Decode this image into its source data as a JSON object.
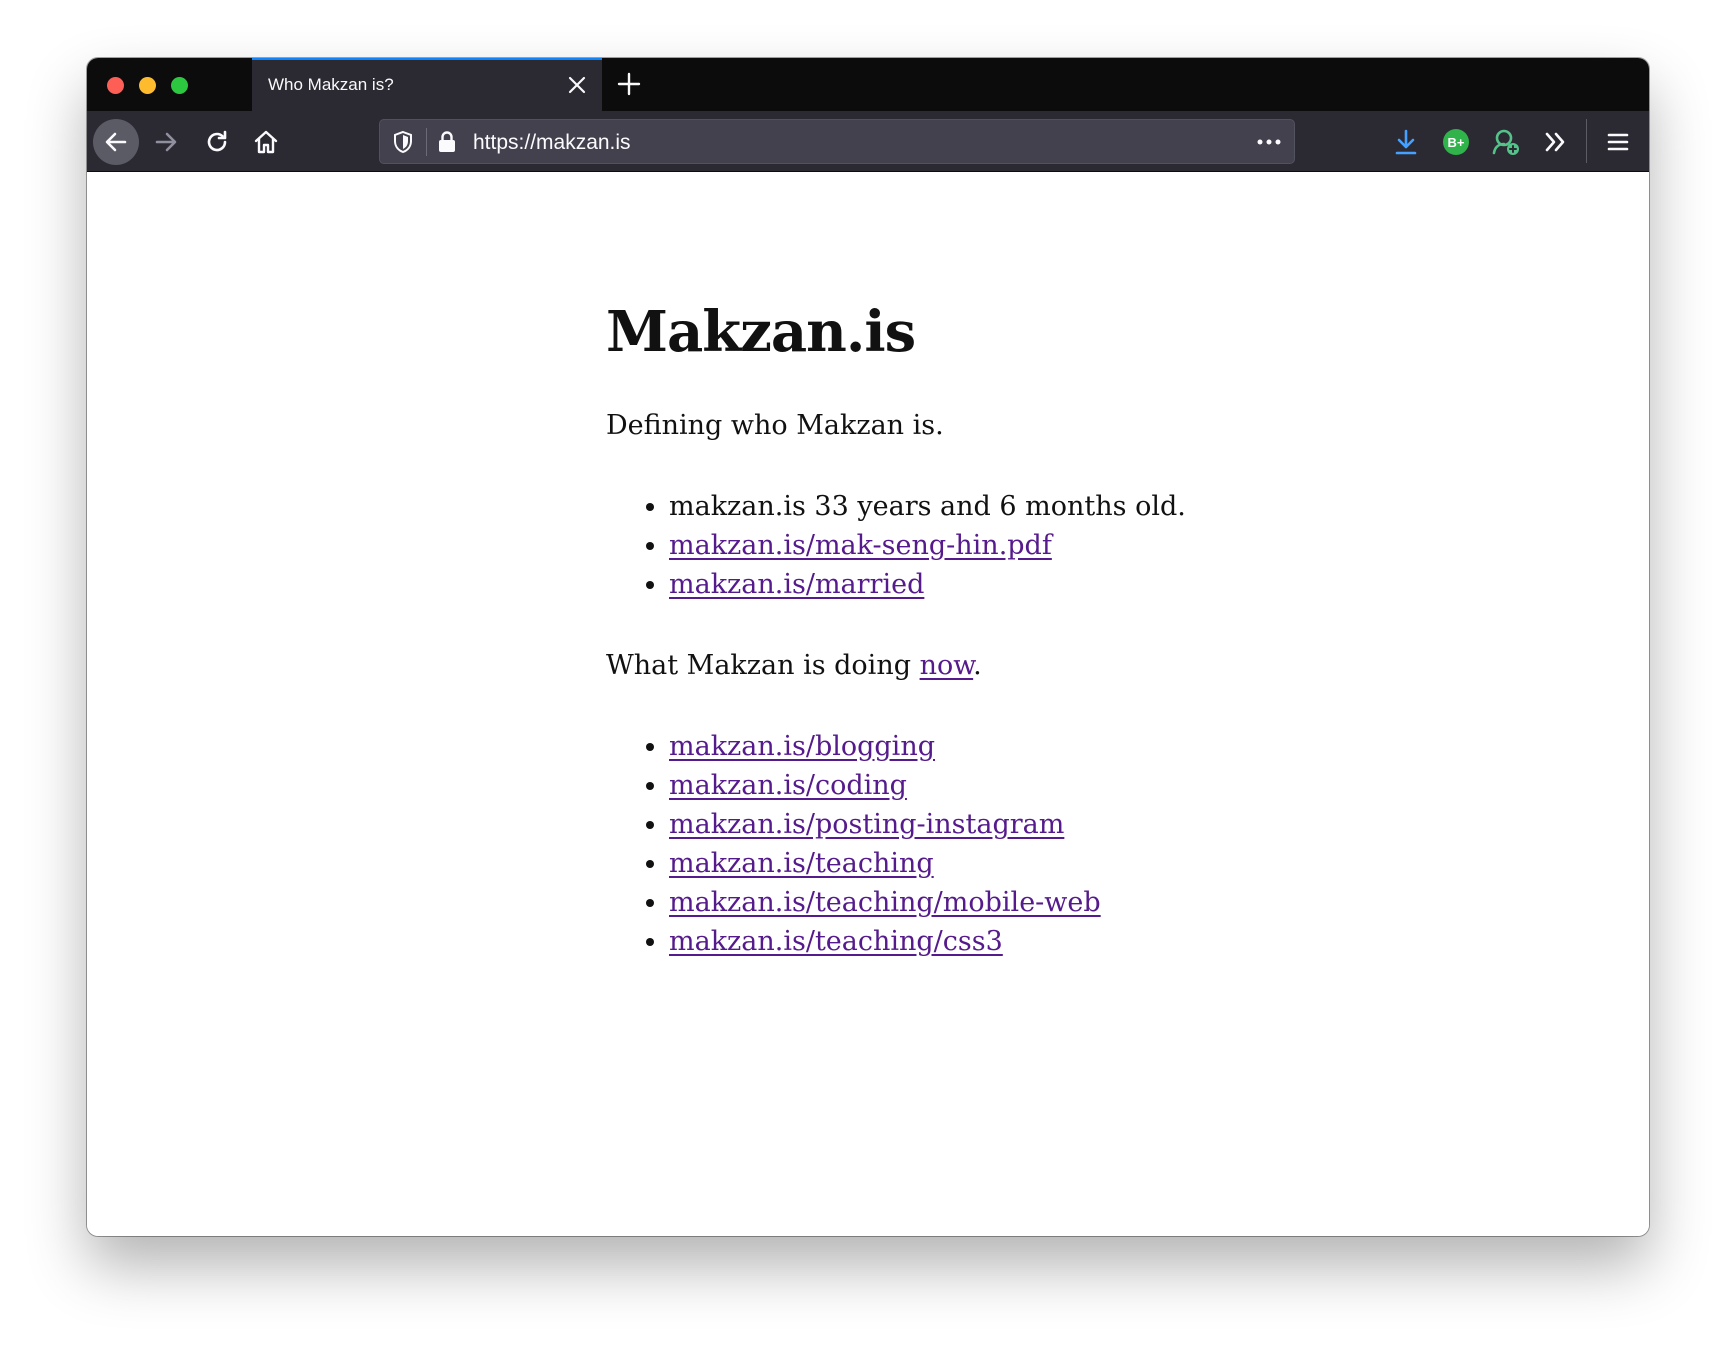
{
  "browser": {
    "tab_title": "Who Makzan is?",
    "url": "https://makzan.is",
    "extension_badge": "B+"
  },
  "page": {
    "title": "Makzan.is",
    "intro": "Defining who Makzan is.",
    "about_items": [
      {
        "text": "makzan.is 33 years and 6 months old.",
        "is_link": false
      },
      {
        "text": "makzan.is/mak-seng-hin.pdf",
        "is_link": true
      },
      {
        "text": "makzan.is/married",
        "is_link": true
      }
    ],
    "doing_prefix": "What Makzan is doing ",
    "doing_link": "now",
    "doing_suffix": ".",
    "activity_items": [
      "makzan.is/blogging",
      "makzan.is/coding",
      "makzan.is/posting-instagram",
      "makzan.is/teaching",
      "makzan.is/teaching/mobile-web",
      "makzan.is/teaching/css3"
    ]
  },
  "colors": {
    "link_visited": "#551a8b",
    "tab_accent": "#0a84ff",
    "chrome_dark": "#0c0c0d",
    "toolbar": "#2b2a33"
  }
}
